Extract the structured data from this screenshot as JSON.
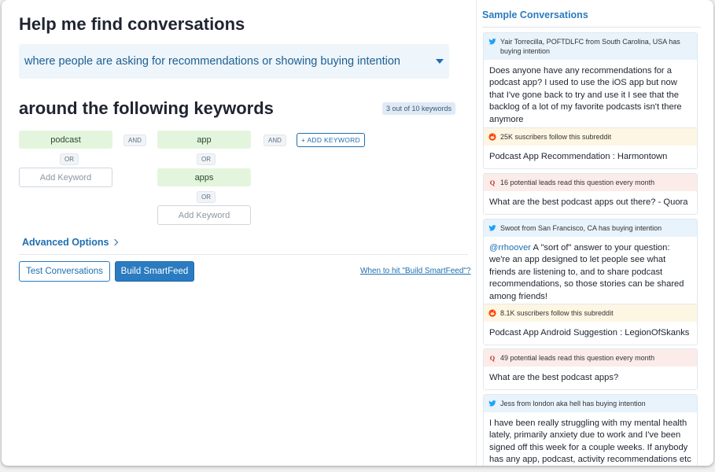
{
  "main": {
    "title": "Help me find conversations",
    "intent_select": "where people are asking for recommendations or showing buying intention",
    "keywords_title": "around the following keywords",
    "keyword_count": "3 out of 10 keywords",
    "columns": [
      {
        "keywords": [
          "podcast"
        ],
        "add_placeholder": "Add Keyword"
      },
      {
        "keywords": [
          "app",
          "apps"
        ],
        "add_placeholder": "Add Keyword"
      }
    ],
    "and_label": "AND",
    "or_label": "OR",
    "add_keyword_button": "+ ADD KEYWORD",
    "advanced_options": "Advanced Options",
    "test_button": "Test Conversations",
    "build_button": "Build SmartFeed",
    "help_link": "When to hit \"Build SmartFeed\"?"
  },
  "sidebar": {
    "title": "Sample Conversations",
    "cards": [
      {
        "source": "twitter",
        "icon": "twitter-icon",
        "header": "Yair Torrecilla, POFTDLFC from South Carolina, USA has buying intention",
        "mention": "",
        "text": "Does anyone have any recommendations for a podcast app? I used to use the iOS app but now that I've gone back to try and use it I see that the backlog of a lot of my favorite podcasts isn't there anymore"
      },
      {
        "source": "reddit",
        "icon": "reddit-icon",
        "header": "25K suscribers follow this subreddit",
        "mention": "",
        "text": "Podcast App Recommendation : Harmontown"
      },
      {
        "source": "quora",
        "icon": "quora-icon",
        "header": "16 potential leads read this question every month",
        "mention": "",
        "text": "What are the best podcast apps out there? - Quora"
      },
      {
        "source": "twitter",
        "icon": "twitter-icon",
        "header": "Swoot from San Francisco, CA has buying intention",
        "mention": "@rrhoover",
        "text": " A \"sort of\" answer to your question: we're an app designed to let people see what friends are listening to, and to share podcast recommendations, so those stories can be shared among friends!"
      },
      {
        "source": "reddit",
        "icon": "reddit-icon",
        "header": "8.1K suscribers follow this subreddit",
        "mention": "",
        "text": "Podcast App Android Suggestion : LegionOfSkanks"
      },
      {
        "source": "quora",
        "icon": "quora-icon",
        "header": "49 potential leads read this question every month",
        "mention": "",
        "text": "What are the best podcast apps?"
      },
      {
        "source": "twitter",
        "icon": "twitter-icon",
        "header": "Jess from london aka hell has buying intention",
        "mention": "",
        "text": "I have been really struggling with my mental health lately, primarily anxiety due to work and I've been signed off this week for a couple weeks. If anybody has any app, podcast, activity recommendations etc"
      }
    ]
  },
  "colors": {
    "accent": "#2a7bc0",
    "keyword_bg": "#e4f5de",
    "twitter": "#1da1f2",
    "reddit": "#ff4500",
    "quora": "#b92b27"
  }
}
